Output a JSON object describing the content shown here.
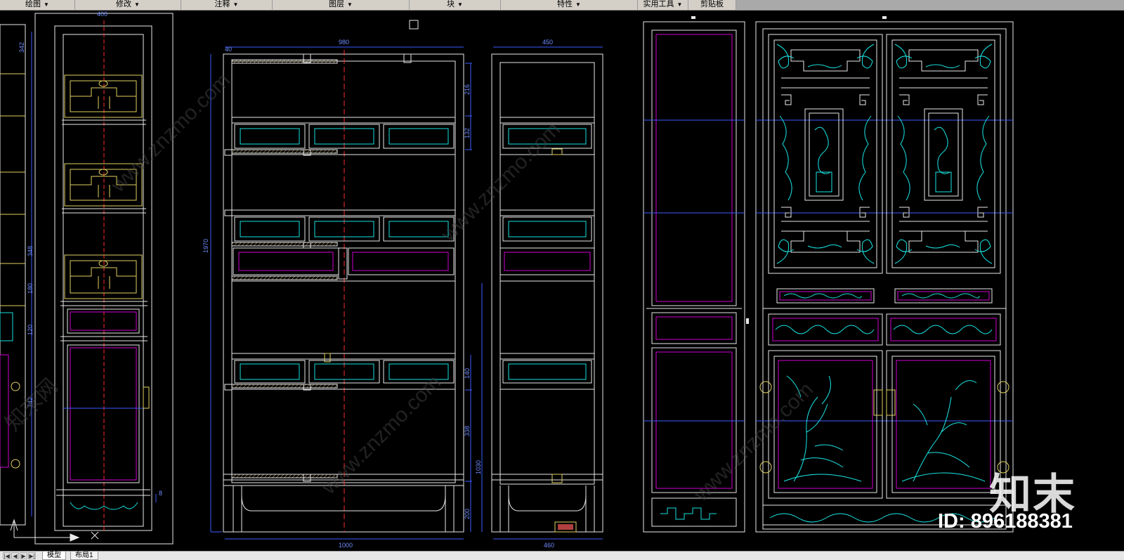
{
  "ribbon": {
    "panels": [
      {
        "label": "绘图",
        "id": "draw"
      },
      {
        "label": "修改",
        "id": "modify"
      },
      {
        "label": "注释",
        "id": "annotate"
      },
      {
        "label": "图层",
        "id": "layers"
      },
      {
        "label": "块",
        "id": "block"
      },
      {
        "label": "特性",
        "id": "properties"
      },
      {
        "label": "实用工具",
        "id": "utilities"
      },
      {
        "label": "剪贴板",
        "id": "clipboard"
      }
    ]
  },
  "dimensions": {
    "top_400": "400",
    "d342": "342",
    "d348": "348",
    "d180": "180",
    "d120": "120",
    "d742": "742",
    "d8": "8",
    "top_40": "40",
    "top_980": "980",
    "d1970": "1970",
    "d216": "216",
    "d132": "132",
    "d140": "140",
    "d338": "338",
    "d1030": "1030",
    "d200": "200",
    "bottom_1000": "1000",
    "top_450": "450",
    "bottom_460": "460"
  },
  "watermark": {
    "text": "www.znzmo.com",
    "cn": "知末网"
  },
  "brand": {
    "logo": "知末",
    "id_label": "ID: 896188381"
  },
  "status": {
    "nav_buttons": [
      "|◀",
      "◀",
      "▶",
      "▶|"
    ],
    "tabs": [
      "模型",
      "布局1"
    ]
  },
  "colors": {
    "outline": "#e8e8e8",
    "dim": "#3c5cff",
    "dimtext": "#6f8cff",
    "center": "#ff2a2a",
    "panel": "#17e0e0",
    "accent": "#d000d0",
    "ornament": "#e0d060",
    "carve": "#19e6e6",
    "ribbon_bg": "#d4d0c8"
  }
}
